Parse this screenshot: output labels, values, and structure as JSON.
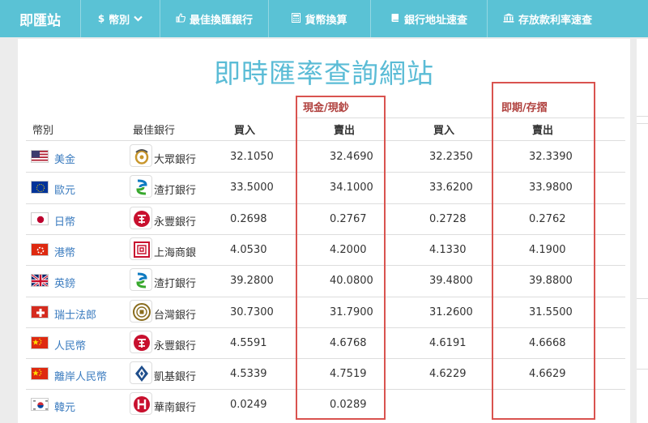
{
  "nav": {
    "brand": "即匯站",
    "currency_label": "幣別",
    "best_bank_label": "最佳換匯銀行",
    "convert_label": "貨幣換算",
    "address_label": "銀行地址速查",
    "rate_label": "存放款利率速查"
  },
  "page": {
    "title": "即時匯率查詢網站"
  },
  "table": {
    "group_cash": "現金/現鈔",
    "group_spot": "即期/存摺",
    "headers": {
      "currency": "幣別",
      "bank": "最佳銀行",
      "cash_buy": "買入",
      "cash_sell": "賣出",
      "spot_buy": "買入",
      "spot_sell": "賣出"
    },
    "rows": [
      {
        "flag": "us-flag",
        "currency": "美金",
        "bank": "大眾銀行",
        "bank_logo": "tcb-logo",
        "cash_buy": "32.1050",
        "cash_sell": "32.4690",
        "spot_buy": "32.2350",
        "spot_sell": "32.3390"
      },
      {
        "flag": "eu-flag",
        "currency": "歐元",
        "bank": "渣打銀行",
        "bank_logo": "stanchart-logo",
        "cash_buy": "33.5000",
        "cash_sell": "34.1000",
        "spot_buy": "33.6200",
        "spot_sell": "33.9800"
      },
      {
        "flag": "jp-flag",
        "currency": "日幣",
        "bank": "永豐銀行",
        "bank_logo": "sinopac-logo",
        "cash_buy": "0.2698",
        "cash_sell": "0.2767",
        "spot_buy": "0.2728",
        "spot_sell": "0.2762"
      },
      {
        "flag": "hk-flag",
        "currency": "港幣",
        "bank": "上海商銀",
        "bank_logo": "scsb-logo",
        "cash_buy": "4.0530",
        "cash_sell": "4.2000",
        "spot_buy": "4.1330",
        "spot_sell": "4.1900"
      },
      {
        "flag": "uk-flag",
        "currency": "英鎊",
        "bank": "渣打銀行",
        "bank_logo": "stanchart-logo",
        "cash_buy": "39.2800",
        "cash_sell": "40.0800",
        "spot_buy": "39.4800",
        "spot_sell": "39.8800"
      },
      {
        "flag": "ch-flag",
        "currency": "瑞士法郎",
        "bank": "台灣銀行",
        "bank_logo": "bot-logo",
        "cash_buy": "30.7300",
        "cash_sell": "31.7900",
        "spot_buy": "31.2600",
        "spot_sell": "31.5500"
      },
      {
        "flag": "cn-flag",
        "currency": "人民幣",
        "bank": "永豐銀行",
        "bank_logo": "sinopac-logo",
        "cash_buy": "4.5591",
        "cash_sell": "4.6768",
        "spot_buy": "4.6191",
        "spot_sell": "4.6668"
      },
      {
        "flag": "cn-flag",
        "currency": "離岸人民幣",
        "bank": "凱基銀行",
        "bank_logo": "kgi-logo",
        "cash_buy": "4.5339",
        "cash_sell": "4.7519",
        "spot_buy": "4.6229",
        "spot_sell": "4.6629"
      },
      {
        "flag": "kr-flag",
        "currency": "韓元",
        "bank": "華南銀行",
        "bank_logo": "hncb-logo",
        "cash_buy": "0.0249",
        "cash_sell": "0.0289",
        "spot_buy": "",
        "spot_sell": ""
      }
    ]
  },
  "colors": {
    "navbar": "#5ac2d5",
    "title": "#5bbcd6",
    "group_label": "#b0413e",
    "highlight_box": "#d9534f",
    "currency_link": "#3a7bbf"
  }
}
